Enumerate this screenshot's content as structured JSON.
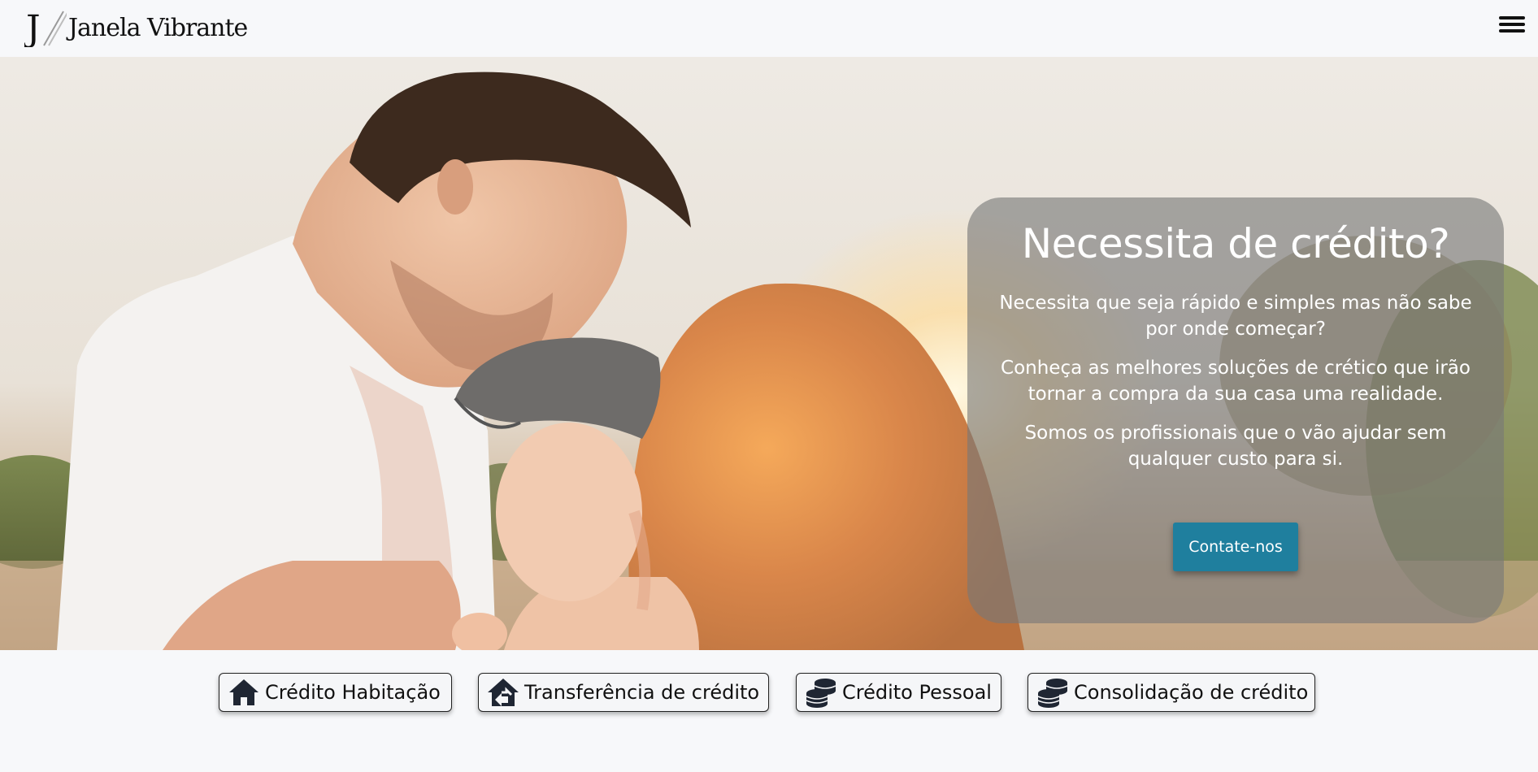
{
  "navbar": {
    "brand_name": "Janela Vibrante",
    "logo_letter": "J",
    "menu_icon": "hamburger-menu-icon"
  },
  "hero": {
    "title": "Necessita de crédito?",
    "paragraphs": [
      "Necessita que seja rápido e simples mas não sabe por onde começar?",
      "Conheça as melhores soluções de crético que irão tornar a compra da sua casa uma realidade.",
      "Somos os profissionais que o vão ajudar sem qualquer custo para si."
    ],
    "cta_label": "Contate-nos",
    "cta_color": "#1f7f9e"
  },
  "services": [
    {
      "label": "Crédito Habitação",
      "icon": "house-icon"
    },
    {
      "label": "Transferência de crédito",
      "icon": "house-transfer-icon"
    },
    {
      "label": "Crédito Pessoal",
      "icon": "coins-icon"
    },
    {
      "label": "Consolidação de crédito",
      "icon": "coins-icon"
    }
  ]
}
